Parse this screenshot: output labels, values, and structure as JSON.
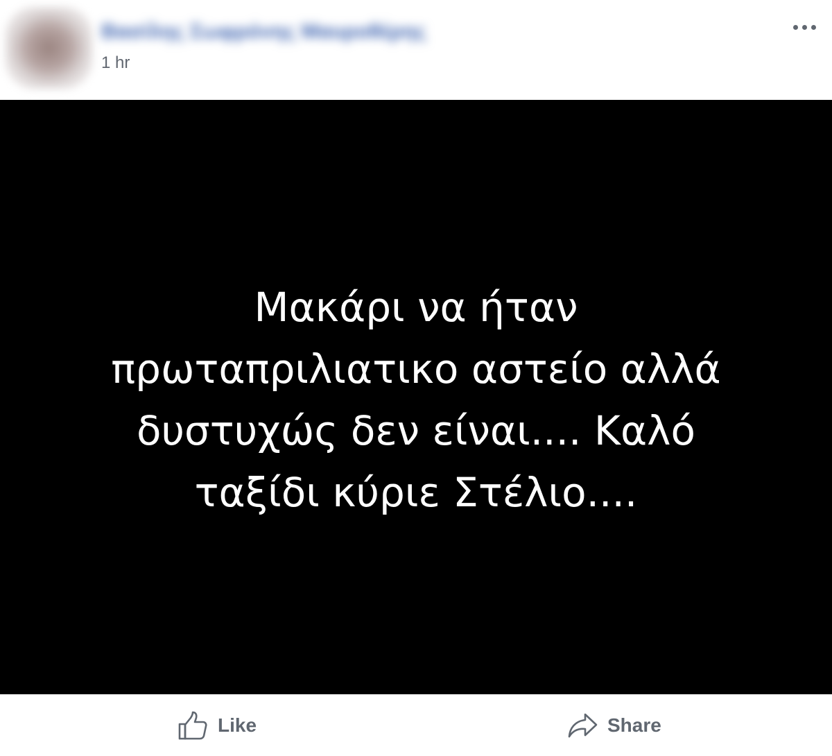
{
  "post": {
    "author": {
      "name": "Βασίλης Σωφρόνης Μαυροθέρης",
      "avatar_icon": "profile-avatar"
    },
    "timestamp": "1 hr",
    "menu_icon": "more-options-icon"
  },
  "content": {
    "background_color": "#000000",
    "text_color": "#ffffff",
    "lines": [
      "Μακάρι να ήταν",
      "πρωταπριλιατικο αστείο αλλά",
      "δυστυχώς δεν είναι.... Καλό",
      "ταξίδι κύριε Στέλιο...."
    ]
  },
  "actions": {
    "like": {
      "label": "Like",
      "icon": "thumbs-up-icon"
    },
    "share": {
      "label": "Share",
      "icon": "share-arrow-icon"
    }
  },
  "colors": {
    "link": "#4267b2",
    "secondary_text": "#616770",
    "action_text": "#606770"
  }
}
